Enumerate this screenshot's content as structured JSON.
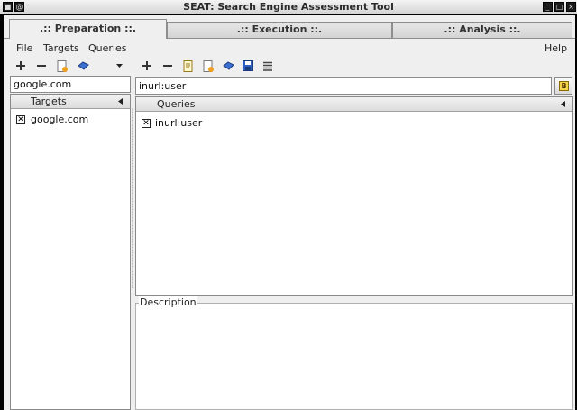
{
  "window": {
    "title": "SEAT: Search Engine Assessment Tool"
  },
  "tabs": [
    {
      "label": ".:: Preparation ::.",
      "active": true
    },
    {
      "label": ".:: Execution ::.",
      "active": false
    },
    {
      "label": ".:: Analysis ::.",
      "active": false
    }
  ],
  "menu": {
    "file": "File",
    "targets": "Targets",
    "queries": "Queries",
    "help": "Help"
  },
  "targets": {
    "input_value": "google.com",
    "header": "Targets",
    "items": [
      {
        "label": "google.com",
        "checked": true
      }
    ]
  },
  "queries": {
    "input_value": "inurl:user",
    "header": "Queries",
    "items": [
      {
        "label": "inurl:user",
        "checked": true
      }
    ]
  },
  "description": {
    "title": "Description"
  },
  "icons": {
    "add": "add-icon",
    "remove": "remove-icon",
    "edit": "edit-icon",
    "new": "new-document-icon",
    "load": "load-icon",
    "save": "save-icon",
    "list": "list-icon",
    "dropdown": "chevron-down-icon",
    "search_engine": "engine-b-icon",
    "sort": "sort-arrow-icon"
  },
  "colors": {
    "titlebar": "#dcdcdc",
    "background": "#efefef",
    "accent_yellow": "#f4d64a"
  }
}
